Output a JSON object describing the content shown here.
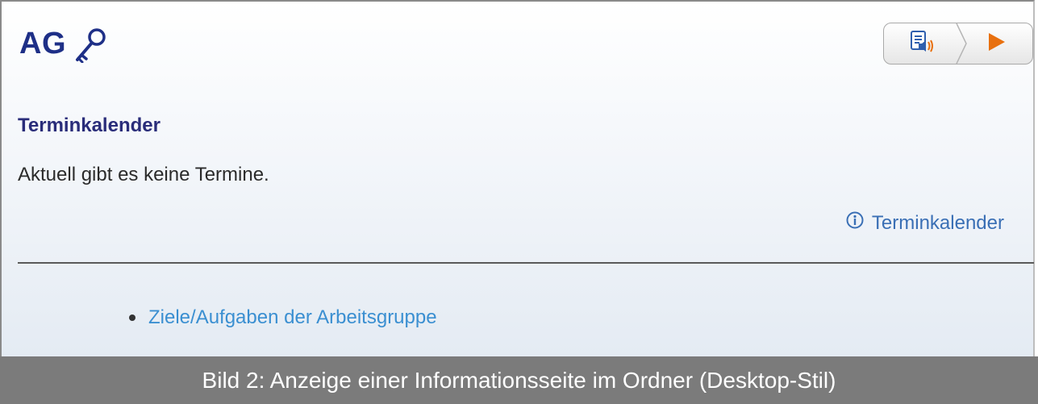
{
  "header": {
    "title": "AG",
    "icon": "key-icon"
  },
  "toolbar": {
    "read_icon": "read-aloud-icon",
    "play_icon": "play-icon"
  },
  "calendar": {
    "heading": "Terminkalender",
    "message": "Aktuell gibt es keine Termine.",
    "link_label": "Terminkalender",
    "link_icon": "info-icon"
  },
  "list": {
    "items": [
      {
        "label": "Ziele/Aufgaben der Arbeitsgruppe"
      }
    ]
  },
  "caption": {
    "text": "Bild 2: Anzeige einer Informationsseite im Ordner (Desktop-Stil)"
  },
  "colors": {
    "heading": "#1e2f87",
    "link": "#3a6fb5",
    "list_link": "#3a8fd1",
    "play": "#e8700f",
    "caption_bg": "#7b7b7b"
  }
}
